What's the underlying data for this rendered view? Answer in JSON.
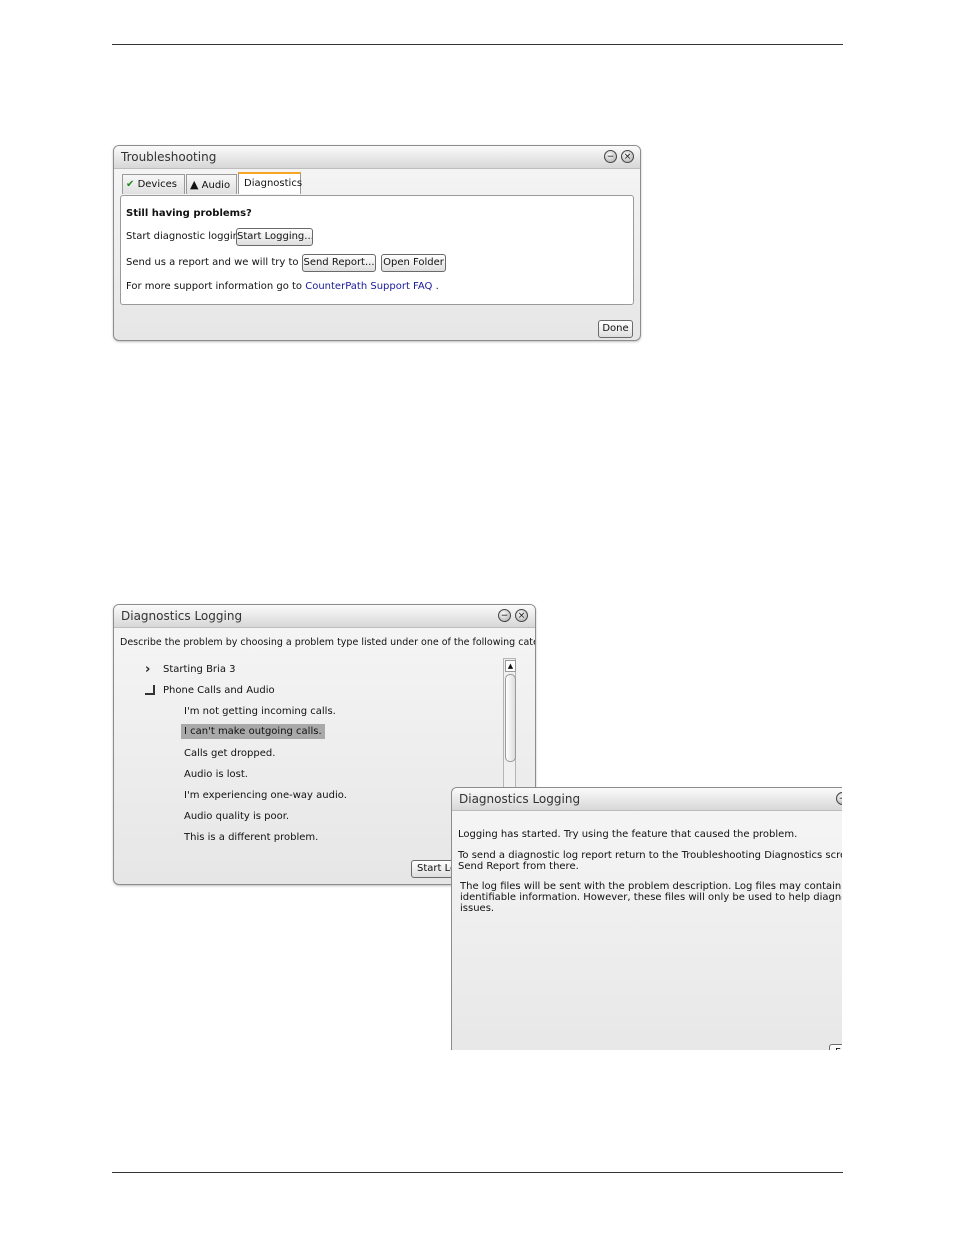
{
  "troubleshooting": {
    "title": "Troubleshooting",
    "tabs": [
      {
        "label": "Devices",
        "icon": "check-icon"
      },
      {
        "label": "Audio",
        "icon": "warning-icon"
      },
      {
        "label": "Diagnostics",
        "active": true
      }
    ],
    "heading": "Still having problems?",
    "logging_label": "Start diagnostic logging.",
    "start_logging_button": "Start Logging...",
    "report_label": "Send us a report and we will try to help.",
    "send_report_button": "Send Report...",
    "open_folder_button": "Open Folder",
    "support_prefix": "For more support information go to",
    "support_link": "CounterPath Support FAQ",
    "support_suffix": ".",
    "done_button": "Done"
  },
  "diag1": {
    "title": "Diagnostics Logging",
    "instruction": "Describe the problem by choosing a problem type listed under one of the following categories:",
    "categories": [
      {
        "label": "Starting Bria 3",
        "expanded": false
      },
      {
        "label": "Phone Calls and Audio",
        "expanded": true
      }
    ],
    "problems": [
      "I'm not getting incoming calls.",
      "I can't make outgoing calls.",
      "Calls get dropped.",
      "Audio is lost.",
      "I'm experiencing one-way audio.",
      "Audio quality is poor.",
      "This is a different problem."
    ],
    "selected_index": 1,
    "start_button": "Start Lo"
  },
  "diag2": {
    "title": "Diagnostics Logging",
    "line1": "Logging has started. Try using the feature that caused the problem.",
    "line2a": "To send a diagnostic log report return to the Troubleshooting Diagnostics screen and click",
    "line2b": "Send Report from there.",
    "line3a": "The log files will be sent with the problem description. Log files may contain personally",
    "line3b": "identifiable information. However, these files will only be used to help diagnose and resolve",
    "line3c": "issues.",
    "button_partial": "F"
  },
  "colors": {
    "accent_tab": "#f5a623",
    "link": "#1a1a9a",
    "check": "#1e8a1e",
    "selection": "#a9a9a9"
  }
}
